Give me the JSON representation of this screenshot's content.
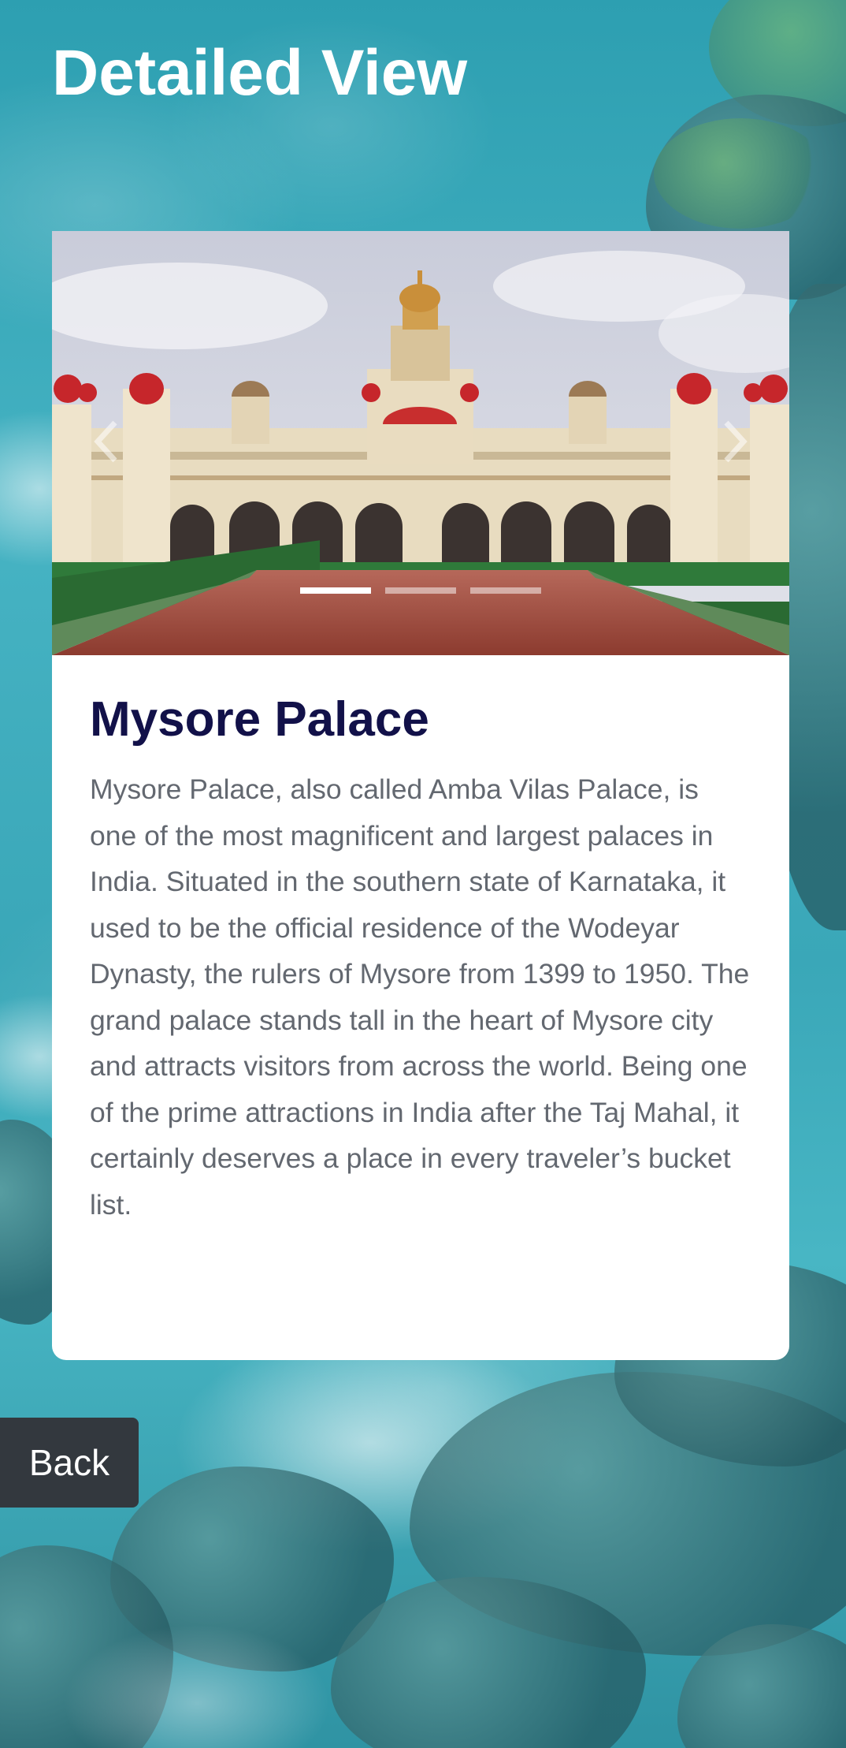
{
  "header": {
    "title": "Detailed View"
  },
  "carousel": {
    "image_alt": "Mysore Palace",
    "prev_icon": "chevron-left-icon",
    "next_icon": "chevron-right-icon",
    "slide_count": 3,
    "active_slide": 1
  },
  "place": {
    "title": "Mysore Palace",
    "description": "Mysore Palace, also called Amba Vilas Palace, is one of the most magnificent and largest palaces in India. Situated in the southern state of Karnataka, it used to be the official residence of the Wodeyar Dynasty, the rulers of Mysore from 1399 to 1950. The grand palace stands tall in the heart of Mysore city and attracts visitors from across the world. Being one of the prime attractions in India after the Taj Mahal, it certainly deserves a place in every traveler’s bucket list."
  },
  "actions": {
    "back_label": "Back"
  },
  "colors": {
    "title_text": "#121149",
    "body_text": "#636870",
    "back_button_bg": "#33383e",
    "background_sea": "#3aa9b9"
  }
}
